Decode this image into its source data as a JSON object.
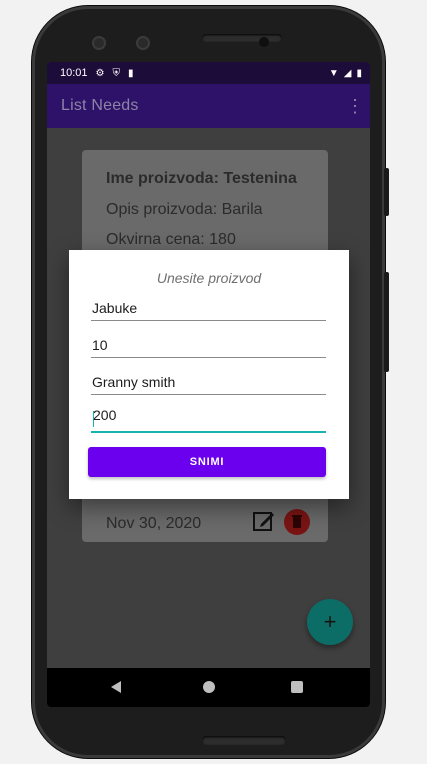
{
  "status_bar": {
    "time": "10:01"
  },
  "app_bar": {
    "title": "List Needs",
    "menu_icon": "more-vert-icon"
  },
  "card": {
    "name": "Ime proizvoda: Testenina",
    "description": "Opis proizvoda: Barila",
    "price": "Okvirna cena: 180",
    "date": "Nov 30, 2020",
    "edit_icon": "edit-icon",
    "delete_icon": "trash-icon"
  },
  "fab": {
    "label": "+"
  },
  "dialog": {
    "title": "Unesite proizvod",
    "fields": [
      "Jabuke",
      "10",
      "Granny smith",
      "200"
    ],
    "save_label": "SNIMI"
  },
  "colors": {
    "appbar": "#2e1168",
    "status_bar": "#1c0c3a",
    "accent": "#6a00ee",
    "teal": "#19b3ad",
    "fab": "#0c6d66"
  }
}
